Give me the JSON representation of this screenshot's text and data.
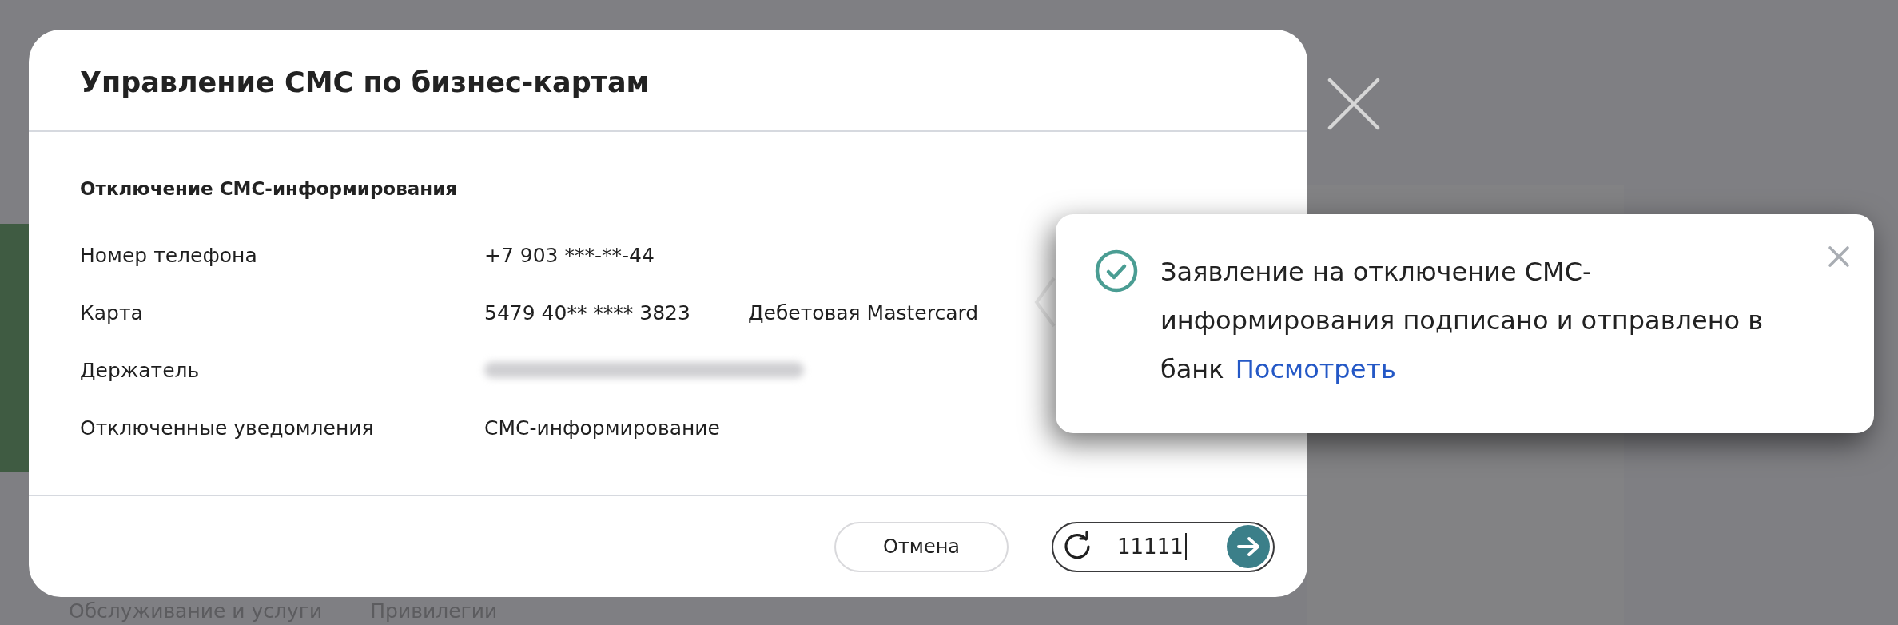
{
  "background_page": {
    "nav_items": [
      "Обслуживание и услуги",
      "Привилегии"
    ]
  },
  "dialog": {
    "title": "Управление СМС по бизнес-картам",
    "section_title": "Отключение СМС-информирования",
    "rows": [
      {
        "label": "Номер телефона",
        "values": [
          "+7 903 ***-**-44"
        ],
        "blurred": false
      },
      {
        "label": "Карта",
        "values": [
          "5479 40** **** 3823",
          "Дебетовая Mastercard"
        ],
        "blurred": false
      },
      {
        "label": "Держатель",
        "blurred": true
      },
      {
        "label": "Отключенные уведомления",
        "values": [
          "СМС-информирование"
        ],
        "blurred": false
      }
    ],
    "cancel_button": "Отмена",
    "code_field": {
      "value": "11111",
      "focused": true
    }
  },
  "toast": {
    "message": "Заявление на отключение СМС-информирования подписано и отправлено в банк",
    "link": "Посмотреть"
  }
}
